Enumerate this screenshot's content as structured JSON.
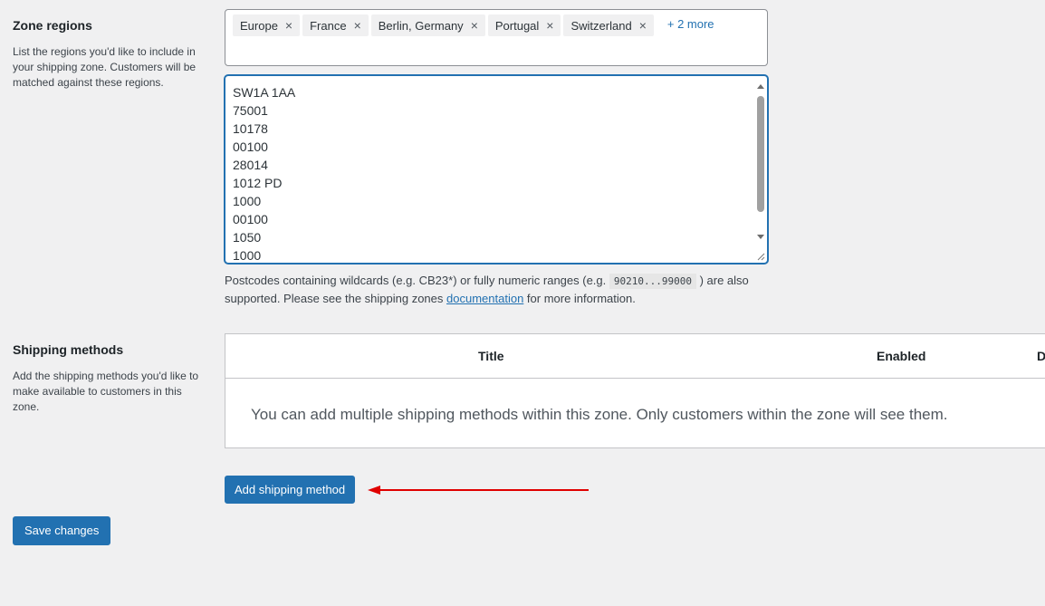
{
  "zone_regions": {
    "title": "Zone regions",
    "description": "List the regions you'd like to include in your shipping zone. Customers will be matched against these regions.",
    "tags": [
      "Europe",
      "France",
      "Berlin, Germany",
      "Portugal",
      "Switzerland"
    ],
    "remove_glyph": "×",
    "more_label": "+ 2 more",
    "postcodes": [
      "SW1A 1AA",
      "75001",
      "10178",
      "00100",
      "28014",
      "1012 PD",
      "1000",
      "00100",
      "1050",
      "1000"
    ],
    "help": {
      "before_code": "Postcodes containing wildcards (e.g. CB23*) or fully numeric ranges (e.g. ",
      "code": "90210...99000",
      "after_code": " ) are also supported. Please see the shipping zones ",
      "link": "documentation",
      "end": " for more information."
    }
  },
  "shipping_methods": {
    "title": "Shipping methods",
    "description": "Add the shipping methods you'd like to make available to customers in this zone.",
    "columns": [
      "Title",
      "Enabled",
      "D"
    ],
    "empty_message": "You can add multiple shipping methods within this zone. Only customers within the zone will see them.",
    "add_button": "Add shipping method"
  },
  "save_button": "Save changes",
  "colors": {
    "primary": "#2271b1",
    "annotation_arrow": "#e00000",
    "background": "#f0f0f1"
  }
}
